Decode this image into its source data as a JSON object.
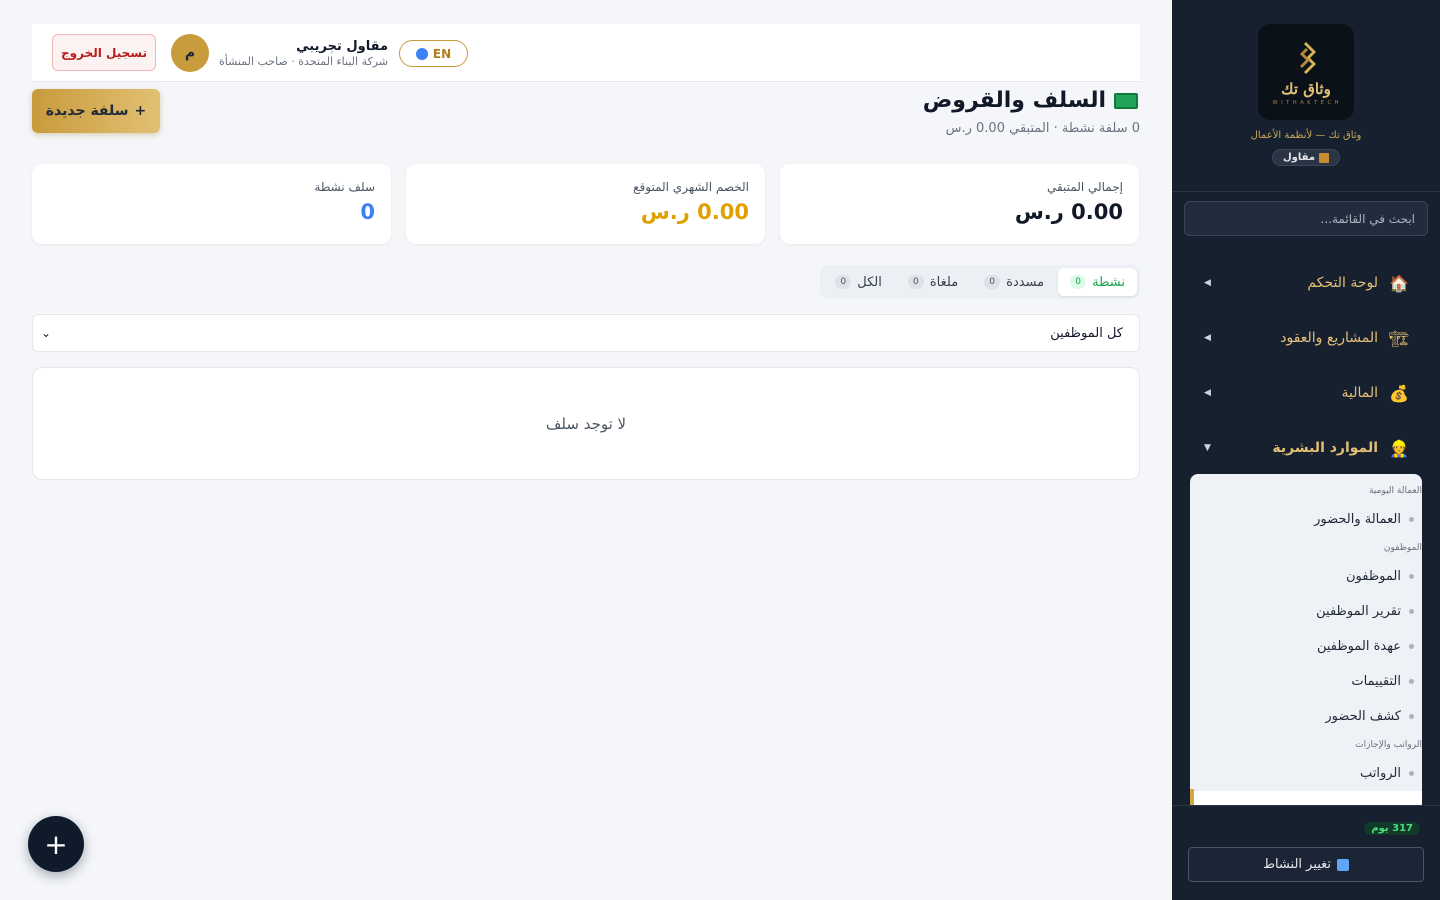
{
  "sidebar": {
    "logo_text": "وثاق تك",
    "logo_sub": "W I T H A K  T E C H",
    "tagline": "وثاق تك — لأنظمة الأعمال",
    "role_badge": "مقاول",
    "search_placeholder": "ابحث في القائمة...",
    "nav": [
      {
        "label": "لوحة التحكم",
        "icon": "house-icon"
      },
      {
        "label": "المشاريع والعقود",
        "icon": "crane-icon"
      },
      {
        "label": "المالية",
        "icon": "money-bag-icon"
      },
      {
        "label": "الموارد البشرية",
        "icon": "worker-icon"
      }
    ],
    "submenu": {
      "groups": [
        "العمالة اليومية",
        "الموظفون",
        "الرواتب والإجازات"
      ],
      "items": [
        "العمالة والحضور",
        "الموظفون",
        "تقرير الموظفين",
        "عهدة الموظفين",
        "التقييمات",
        "كشف الحضور",
        "الرواتب"
      ]
    },
    "days_badge": "317 يوم",
    "switch_label": "تغيير النشاط"
  },
  "topbar": {
    "avatar_letter": "م",
    "user_name": "مقاول تجريبي",
    "user_sub": "شركة البناء المتحدة · صاحب المنشأة",
    "lang_label": "EN",
    "logout_label": "تسجيل الخروج"
  },
  "page": {
    "title": "السلف والقروض",
    "subtitle": "0 سلفة نشطة · المتبقي 0.00 ر.س",
    "new_button": "سلفة جديدة",
    "new_button_prefix": "+"
  },
  "stats": [
    {
      "label": "إجمالي المتبقي",
      "value": "0.00 ر.س",
      "color": "#111827"
    },
    {
      "label": "الخصم الشهري المتوقع",
      "value": "0.00 ر.س",
      "color": "#e0a100"
    },
    {
      "label": "سلف نشطة",
      "value": "0",
      "color": "#3b82f6"
    }
  ],
  "tabs": [
    {
      "label": "نشطة",
      "count": "0",
      "active": true
    },
    {
      "label": "مسددة",
      "count": "0",
      "active": false
    },
    {
      "label": "ملغاة",
      "count": "0",
      "active": false
    },
    {
      "label": "الكل",
      "count": "0",
      "active": false
    }
  ],
  "filter": {
    "employee_select": "كل الموظفين"
  },
  "empty_message": "لا توجد سلف",
  "fab_label": "+",
  "colors": {
    "sidebar_bg": "#17202f",
    "accent_gold": "#c89b3c",
    "active_green": "#16a34a",
    "danger_red": "#b91c1c"
  }
}
